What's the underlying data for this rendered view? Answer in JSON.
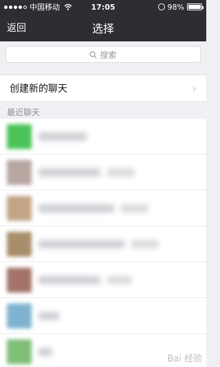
{
  "status_bar": {
    "carrier": "中国移动",
    "time": "17:05",
    "battery": "98%",
    "battery_level": 0.98
  },
  "nav": {
    "back_label": "返回",
    "title": "选择"
  },
  "search": {
    "placeholder": "搜索"
  },
  "new_chat": {
    "label": "创建新的聊天"
  },
  "section": {
    "recent_label": "最近聊天"
  },
  "contacts": [
    {
      "avatar_color": "#4cc35a",
      "name": "",
      "blurred": true
    },
    {
      "avatar_color": "#b7a6a0",
      "name": "",
      "blurred": true
    },
    {
      "avatar_color": "#c3a486",
      "name": "",
      "blurred": true
    },
    {
      "avatar_color": "#a88e6a",
      "name": "",
      "blurred": true
    },
    {
      "avatar_color": "#a3736a",
      "name": "",
      "blurred": true
    },
    {
      "avatar_color": "#7fb3d0",
      "name": "",
      "blurred": true
    },
    {
      "avatar_color": "#7fbf78",
      "name": "",
      "blurred": true
    }
  ],
  "watermark": "Bai 经验",
  "colors": {
    "bar_bg": "#2d2d32",
    "page_bg": "#efeff4",
    "accent_green": "#4cc35a"
  }
}
